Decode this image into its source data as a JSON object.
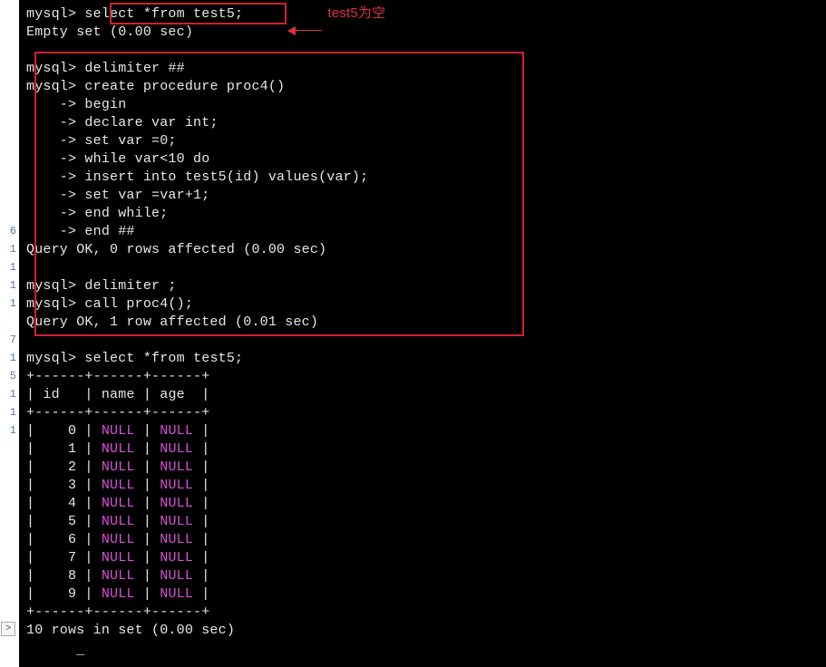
{
  "gutter_numbers": [
    "6",
    "1",
    "1",
    "1",
    "1",
    "",
    "7",
    "1",
    "5",
    "1",
    "1",
    "1"
  ],
  "scroll_glyph": ">",
  "box_annotation": "test5为空",
  "prompt": "mysql>",
  "cont": "    ->",
  "top": {
    "cmd1": "select *from test5;",
    "result1": "Empty set (0.00 sec)"
  },
  "proc": {
    "l1": "delimiter ##",
    "l2": "create procedure proc4()",
    "c1": "begin",
    "c2": "declare var int;",
    "c3": "set var =0;",
    "c4": "while var<10 do",
    "c5": "insert into test5(id) values(var);",
    "c6": "set var =var+1;",
    "c7": "end while;",
    "c8": "end ##",
    "result": "Query OK, 0 rows affected (0.00 sec)",
    "l3": "delimiter ;",
    "l4": "call proc4();",
    "result2": "Query OK, 1 row affected (0.01 sec)"
  },
  "select2": {
    "cmd": "select *from test5;",
    "sep": "+------+------+------+",
    "header_id": "id",
    "header_name": "name",
    "header_age": "age",
    "null_text": "NULL",
    "rows": [
      "0",
      "1",
      "2",
      "3",
      "4",
      "5",
      "6",
      "7",
      "8",
      "9"
    ],
    "footer": "10 rows in set (0.00 sec)"
  }
}
